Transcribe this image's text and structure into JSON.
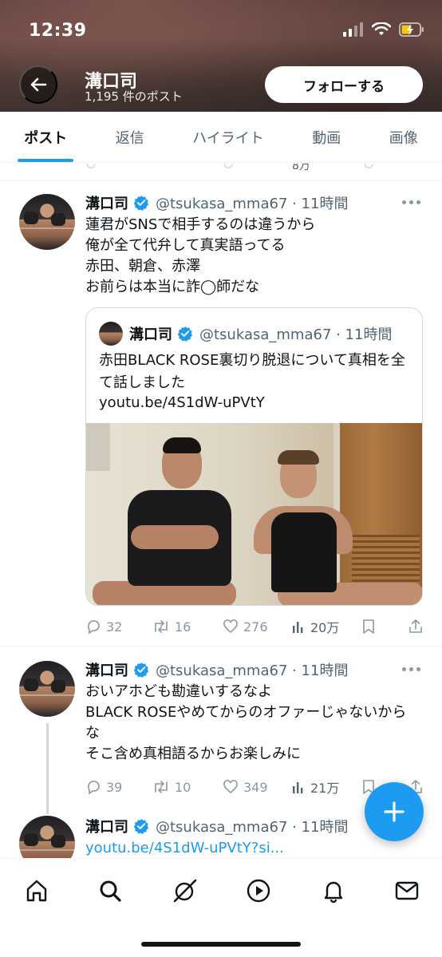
{
  "status_bar": {
    "time": "12:39"
  },
  "header": {
    "profile_name": "溝口司",
    "post_count": "1,195 件のポスト",
    "follow_label": "フォローする"
  },
  "tabs": [
    {
      "label": "ポスト",
      "active": true
    },
    {
      "label": "返信",
      "active": false
    },
    {
      "label": "ハイライト",
      "active": false
    },
    {
      "label": "動画",
      "active": false
    },
    {
      "label": "画像",
      "active": false
    }
  ],
  "cut_row": {
    "views": "8万"
  },
  "tweets": [
    {
      "author": "溝口司",
      "handle": "@tsukasa_mma67 · 11時間",
      "text": "蓮君がSNSで相手するのは違うから\n俺が全て代弁して真実語ってる\n赤田、朝倉、赤澤\nお前らは本当に詐◯師だな",
      "quote": {
        "author": "溝口司",
        "handle": "@tsukasa_mma67 · 11時間",
        "text": "赤田BLACK ROSE裏切り脱退について真相を全て話しました",
        "link": "youtu.be/4S1dW-uPVtY"
      },
      "stats": {
        "replies": "32",
        "reposts": "16",
        "likes": "276",
        "views": "20万"
      }
    },
    {
      "author": "溝口司",
      "handle": "@tsukasa_mma67 · 11時間",
      "text": "おいアホども勘違いするなよ\nBLACK ROSEやめてからのオファーじゃないからな\nそこ含め真相語るからお楽しみに",
      "stats": {
        "replies": "39",
        "reposts": "10",
        "likes": "349",
        "views": "21万"
      }
    },
    {
      "author": "溝口司",
      "handle": "@tsukasa_mma67 · 11時間",
      "link": "youtu.be/4S1dW-uPVtY?si..."
    }
  ],
  "colors": {
    "accent": "#1d9bf0",
    "text": "#0f1419",
    "muted": "#536471"
  },
  "bottom_nav": [
    "home-icon",
    "search-icon",
    "grok-icon",
    "video-icon",
    "notifications-icon",
    "messages-icon"
  ]
}
